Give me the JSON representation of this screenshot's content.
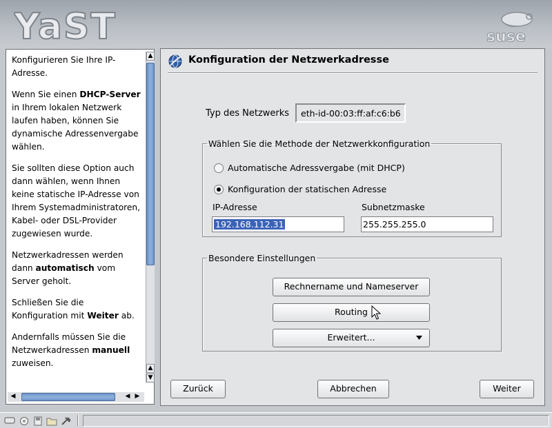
{
  "header": {
    "logo_text": "YaST",
    "brand_text": "suse"
  },
  "help": {
    "paragraphs": [
      {
        "text": "Konfigurieren Sie Ihre IP-Adresse."
      },
      {
        "before": "Wenn Sie einen ",
        "bold": "DHCP-Server",
        "after": " in Ihrem lokalen Netzwerk laufen haben, können Sie dynamische Adressenvergabe wählen."
      },
      {
        "text": "Sie sollten diese Option auch dann wählen, wenn Ihnen keine statische IP-Adresse von Ihrem Systemadministratoren, Kabel- oder DSL-Provider zugewiesen wurde."
      },
      {
        "before": "Netzwerkadressen werden dann ",
        "bold": "automatisch",
        "after": " vom Server geholt."
      },
      {
        "before": "Schließen Sie die Konfiguration mit ",
        "bold": "Weiter",
        "after": " ab."
      },
      {
        "before": "Andernfalls müssen Sie die Netzwerkadressen ",
        "bold": "manuell",
        "after": " zuweisen."
      }
    ]
  },
  "dialog": {
    "title": "Konfiguration der Netzwerkadresse",
    "network_type_label": "Typ des Netzwerks",
    "network_type_value": "eth-id-00:03:ff:af:c6:b6",
    "method_group": {
      "legend": "Wählen Sie die Methode der Netzwerkkonfiguration",
      "option_dhcp": "Automatische Adressvergabe (mit DHCP)",
      "option_static": "Konfiguration der statischen Adresse",
      "selected": "static"
    },
    "ip_label": "IP-Adresse",
    "ip_value": "192.168.112.31",
    "netmask_label": "Subnetzmaske",
    "netmask_value": "255.255.255.0",
    "special_group": {
      "legend": "Besondere Einstellungen",
      "hostname_button": "Rechnername und Nameserver",
      "routing_button": "Routing",
      "advanced_button": "Erweitert..."
    },
    "back_button": "Zurück",
    "cancel_button": "Abbrechen",
    "next_button": "Weiter"
  }
}
